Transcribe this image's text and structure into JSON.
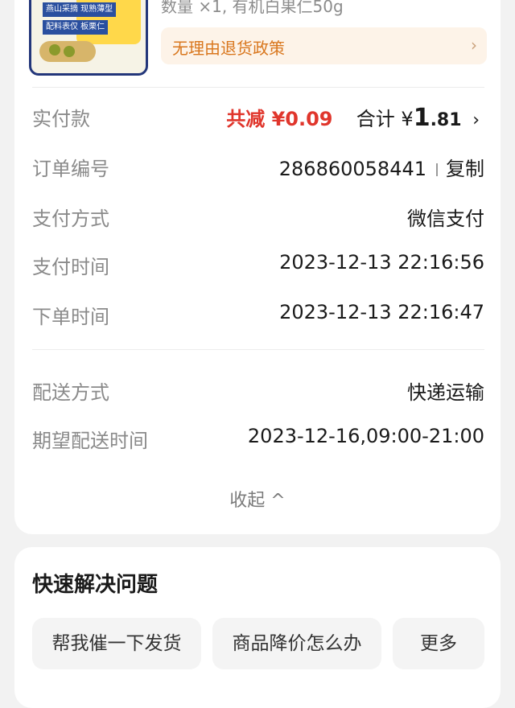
{
  "product": {
    "qty_text": "数量 ×1, 有机白果仁50g",
    "thumb_tag_top": "燕山采摘 现熟薄型",
    "thumb_tag_mid": "配料表仅 板栗仁"
  },
  "refund_policy": {
    "label": "无理由退货政策",
    "chevron": "›"
  },
  "order": {
    "paid": {
      "label": "实付款",
      "discount": "共减 ¥0.09",
      "total_prefix": "合计 ¥",
      "total_int": "1",
      "total_dec": ".81",
      "chevron": "›"
    },
    "order_no": {
      "label": "订单编号",
      "value": "286860058441",
      "copy": "复制"
    },
    "pay_method": {
      "label": "支付方式",
      "value": "微信支付"
    },
    "pay_time": {
      "label": "支付时间",
      "value": "2023-12-13 22:16:56"
    },
    "order_time": {
      "label": "下单时间",
      "value": "2023-12-13 22:16:47"
    },
    "delivery": {
      "label": "配送方式",
      "value": "快递运输"
    },
    "expected": {
      "label": "期望配送时间",
      "value": "2023-12-16,09:00-21:00"
    },
    "collapse": "收起 ^"
  },
  "quick_solve": {
    "title": "快速解决问题",
    "chips": [
      "帮我催一下发货",
      "商品降价怎么办",
      "更多"
    ]
  }
}
